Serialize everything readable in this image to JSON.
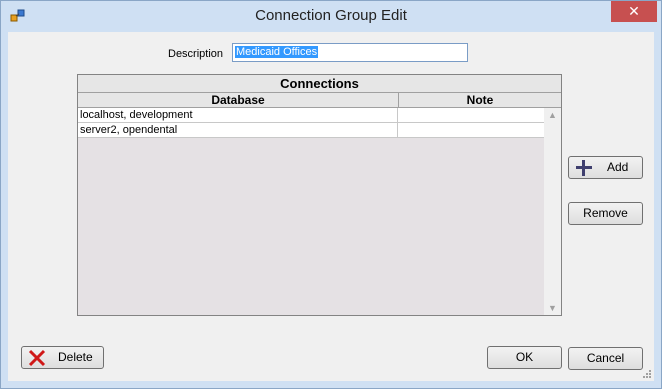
{
  "window": {
    "title": "Connection Group Edit",
    "close_glyph": "✕"
  },
  "description": {
    "label": "Description",
    "value": "Medicaid Offices"
  },
  "grid": {
    "title": "Connections",
    "columns": [
      "Database",
      "Note"
    ],
    "rows": [
      {
        "database": "localhost, development",
        "note": ""
      },
      {
        "database": "server2, opendental",
        "note": ""
      }
    ]
  },
  "buttons": {
    "add": "Add",
    "remove": "Remove",
    "delete": "Delete",
    "ok": "OK",
    "cancel": "Cancel"
  },
  "colors": {
    "accent": "#3399ff",
    "close": "#c75050",
    "grid_bg": "#e5e1e4"
  },
  "icons": {
    "app": "app-icon",
    "add": "plus-icon",
    "delete": "red-x-icon"
  }
}
